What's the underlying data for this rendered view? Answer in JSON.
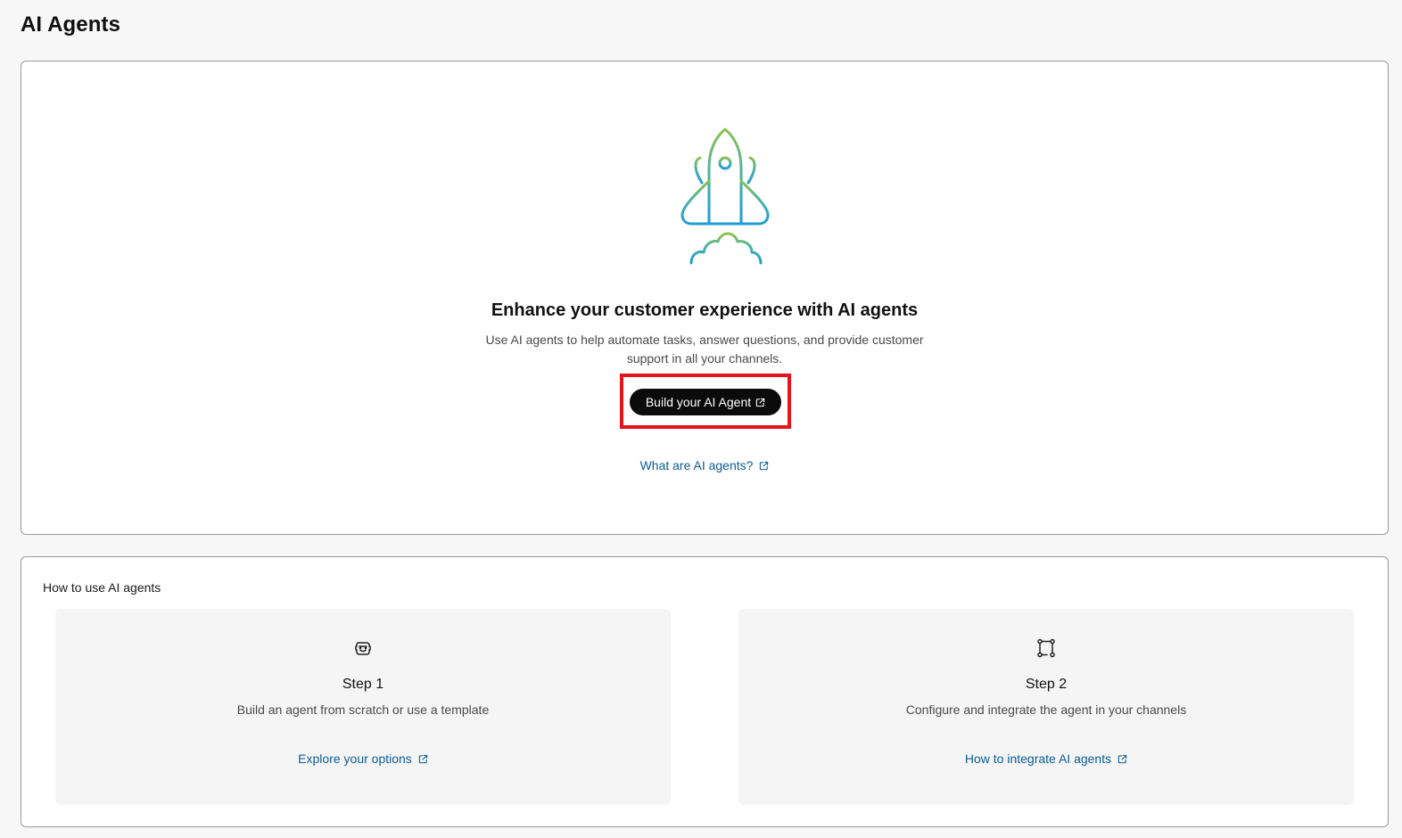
{
  "page": {
    "title": "AI Agents"
  },
  "hero": {
    "title": "Enhance your customer experience with AI agents",
    "description": "Use AI agents to help automate tasks, answer questions, and provide customer support in all your channels.",
    "build_button_label": "Build your AI Agent",
    "learn_link_label": "What are AI agents?"
  },
  "how_to": {
    "title": "How to use AI agents",
    "steps": [
      {
        "title": "Step 1",
        "description": "Build an agent from scratch or use a template",
        "link_label": "Explore your options",
        "icon": "robot-icon"
      },
      {
        "title": "Step 2",
        "description": "Configure and integrate the agent in your channels",
        "link_label": "How to integrate AI agents",
        "icon": "flow-icon"
      }
    ]
  },
  "colors": {
    "link": "#0a5c96",
    "button_bg": "#0b0b0b",
    "highlight": "#e3141c",
    "rocket_top": "#8cc152",
    "rocket_bottom": "#1e9bd7"
  }
}
